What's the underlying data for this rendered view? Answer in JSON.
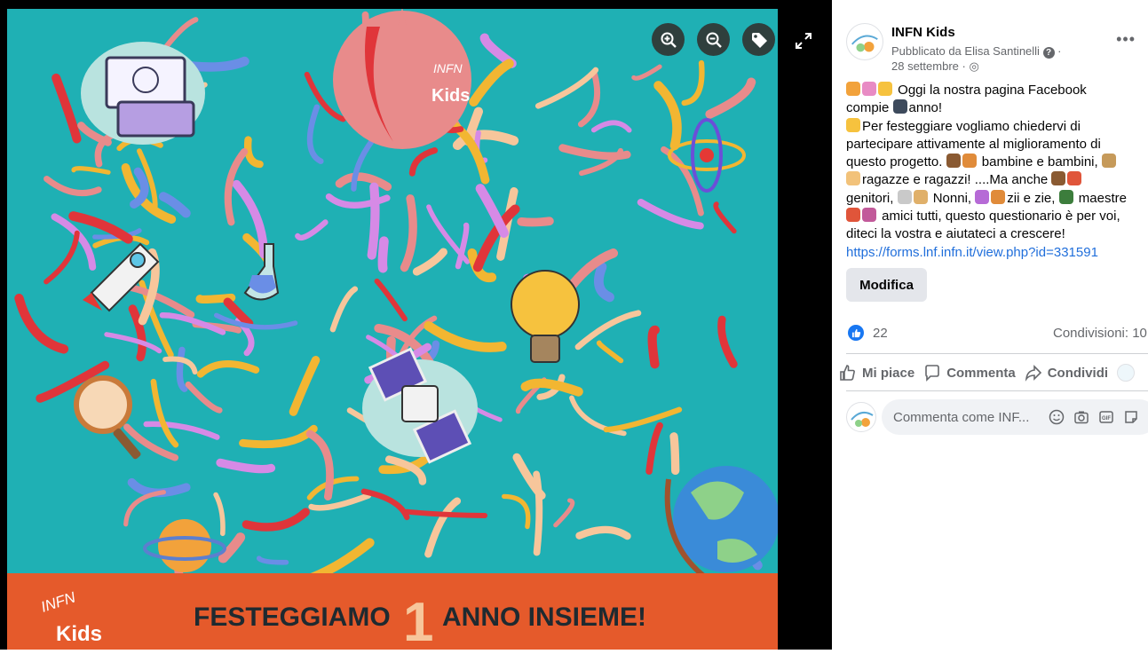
{
  "viewer": {
    "poster": {
      "banner_text_left": "FESTEGGIAMO",
      "banner_number": "1",
      "banner_text_right": "ANNO INSIEME!",
      "logo_top": "INFN",
      "logo_bottom": "Kids",
      "colors": {
        "background": "#1fb0b4",
        "banner": "#e55a2b",
        "banner_text": "#1f2a30"
      }
    },
    "tools": [
      "zoom-in-icon",
      "zoom-out-icon",
      "tag-icon",
      "expand-icon"
    ]
  },
  "post": {
    "page_name": "INFN Kids",
    "posted_by": "Pubblicato da Elisa Santinelli",
    "date": "28 settembre",
    "lines": [
      "Oggi la nostra pagina Facebook",
      "compie",
      "anno!",
      "Per festeggiare vogliamo chiedervi di",
      "partecipare attivamente al miglioramento di",
      "questo progetto.",
      "bambine e bambini,",
      "ragazze e ragazzi! ....Ma anche",
      "genitori,",
      "Nonni,",
      "zii e zie,",
      "maestre",
      "amici tutti, questo questionario è per voi,",
      "diteci la vostra e aiutateci a crescere!"
    ],
    "link": "https://forms.lnf.infn.it/view.php?id=331591",
    "edit_label": "Modifica",
    "like_count": "22",
    "shares": "Condivisioni: 10",
    "actions": {
      "like": "Mi piace",
      "comment": "Commenta",
      "share": "Condividi"
    },
    "comment_placeholder": "Commenta come INF...",
    "colors": {
      "link": "#216fdb",
      "accent": "#1877f2"
    }
  }
}
